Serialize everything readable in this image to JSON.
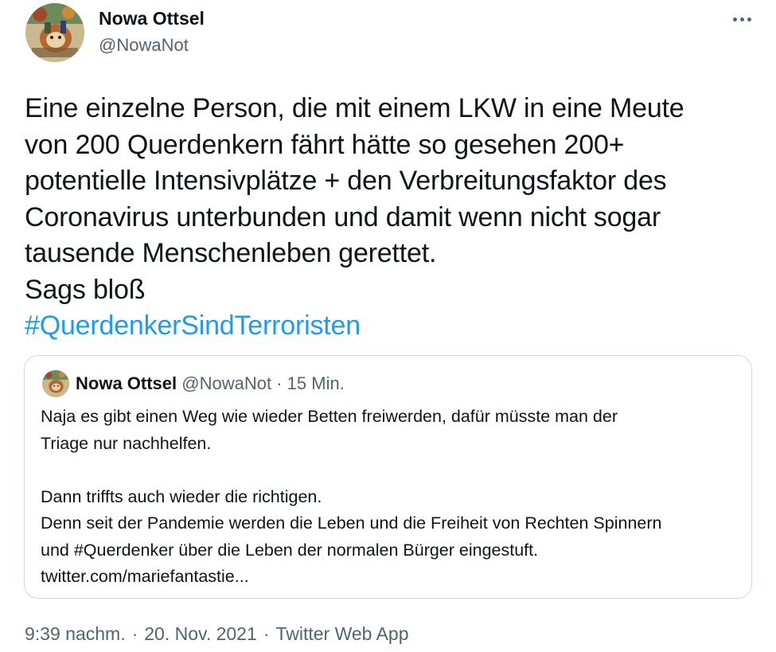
{
  "author": {
    "name": "Nowa Ottsel",
    "handle": "@NowaNot"
  },
  "tweet": {
    "lines": [
      "Eine einzelne Person, die mit einem LKW in eine Meute",
      "von 200 Querdenkern fährt hätte so gesehen 200+",
      "potentielle Intensivplätze + den Verbreitungsfaktor des",
      "Coronavirus unterbunden und damit wenn nicht sogar",
      "tausende Menschenleben gerettet.",
      "Sags bloß"
    ],
    "hashtag": "#QuerdenkerSindTerroristen"
  },
  "quoted": {
    "name": "Nowa Ottsel",
    "handle": "@NowaNot",
    "dot": "·",
    "time": "15 Min.",
    "lines": [
      "Naja es gibt einen Weg wie wieder Betten freiwerden, dafür müsste man der",
      "Triage nur nachhelfen.",
      "",
      "Dann triffts auch wieder die richtigen.",
      "Denn seit der Pandemie werden die Leben und die Freiheit von Rechten Spinnern",
      "und #Querdenker über die Leben der normalen Bürger eingestuft.",
      "twitter.com/mariefantastie..."
    ]
  },
  "footer": {
    "time": "9:39 nachm.",
    "sep": "·",
    "date": "20. Nov. 2021",
    "app": "Twitter Web App"
  },
  "icons": {
    "more": "more-horizontal-icon",
    "avatar": "avatar-illustration"
  },
  "colors": {
    "text": "#0f1419",
    "secondary": "#536471",
    "link": "#1d9bf0",
    "border": "#cfd9de"
  }
}
